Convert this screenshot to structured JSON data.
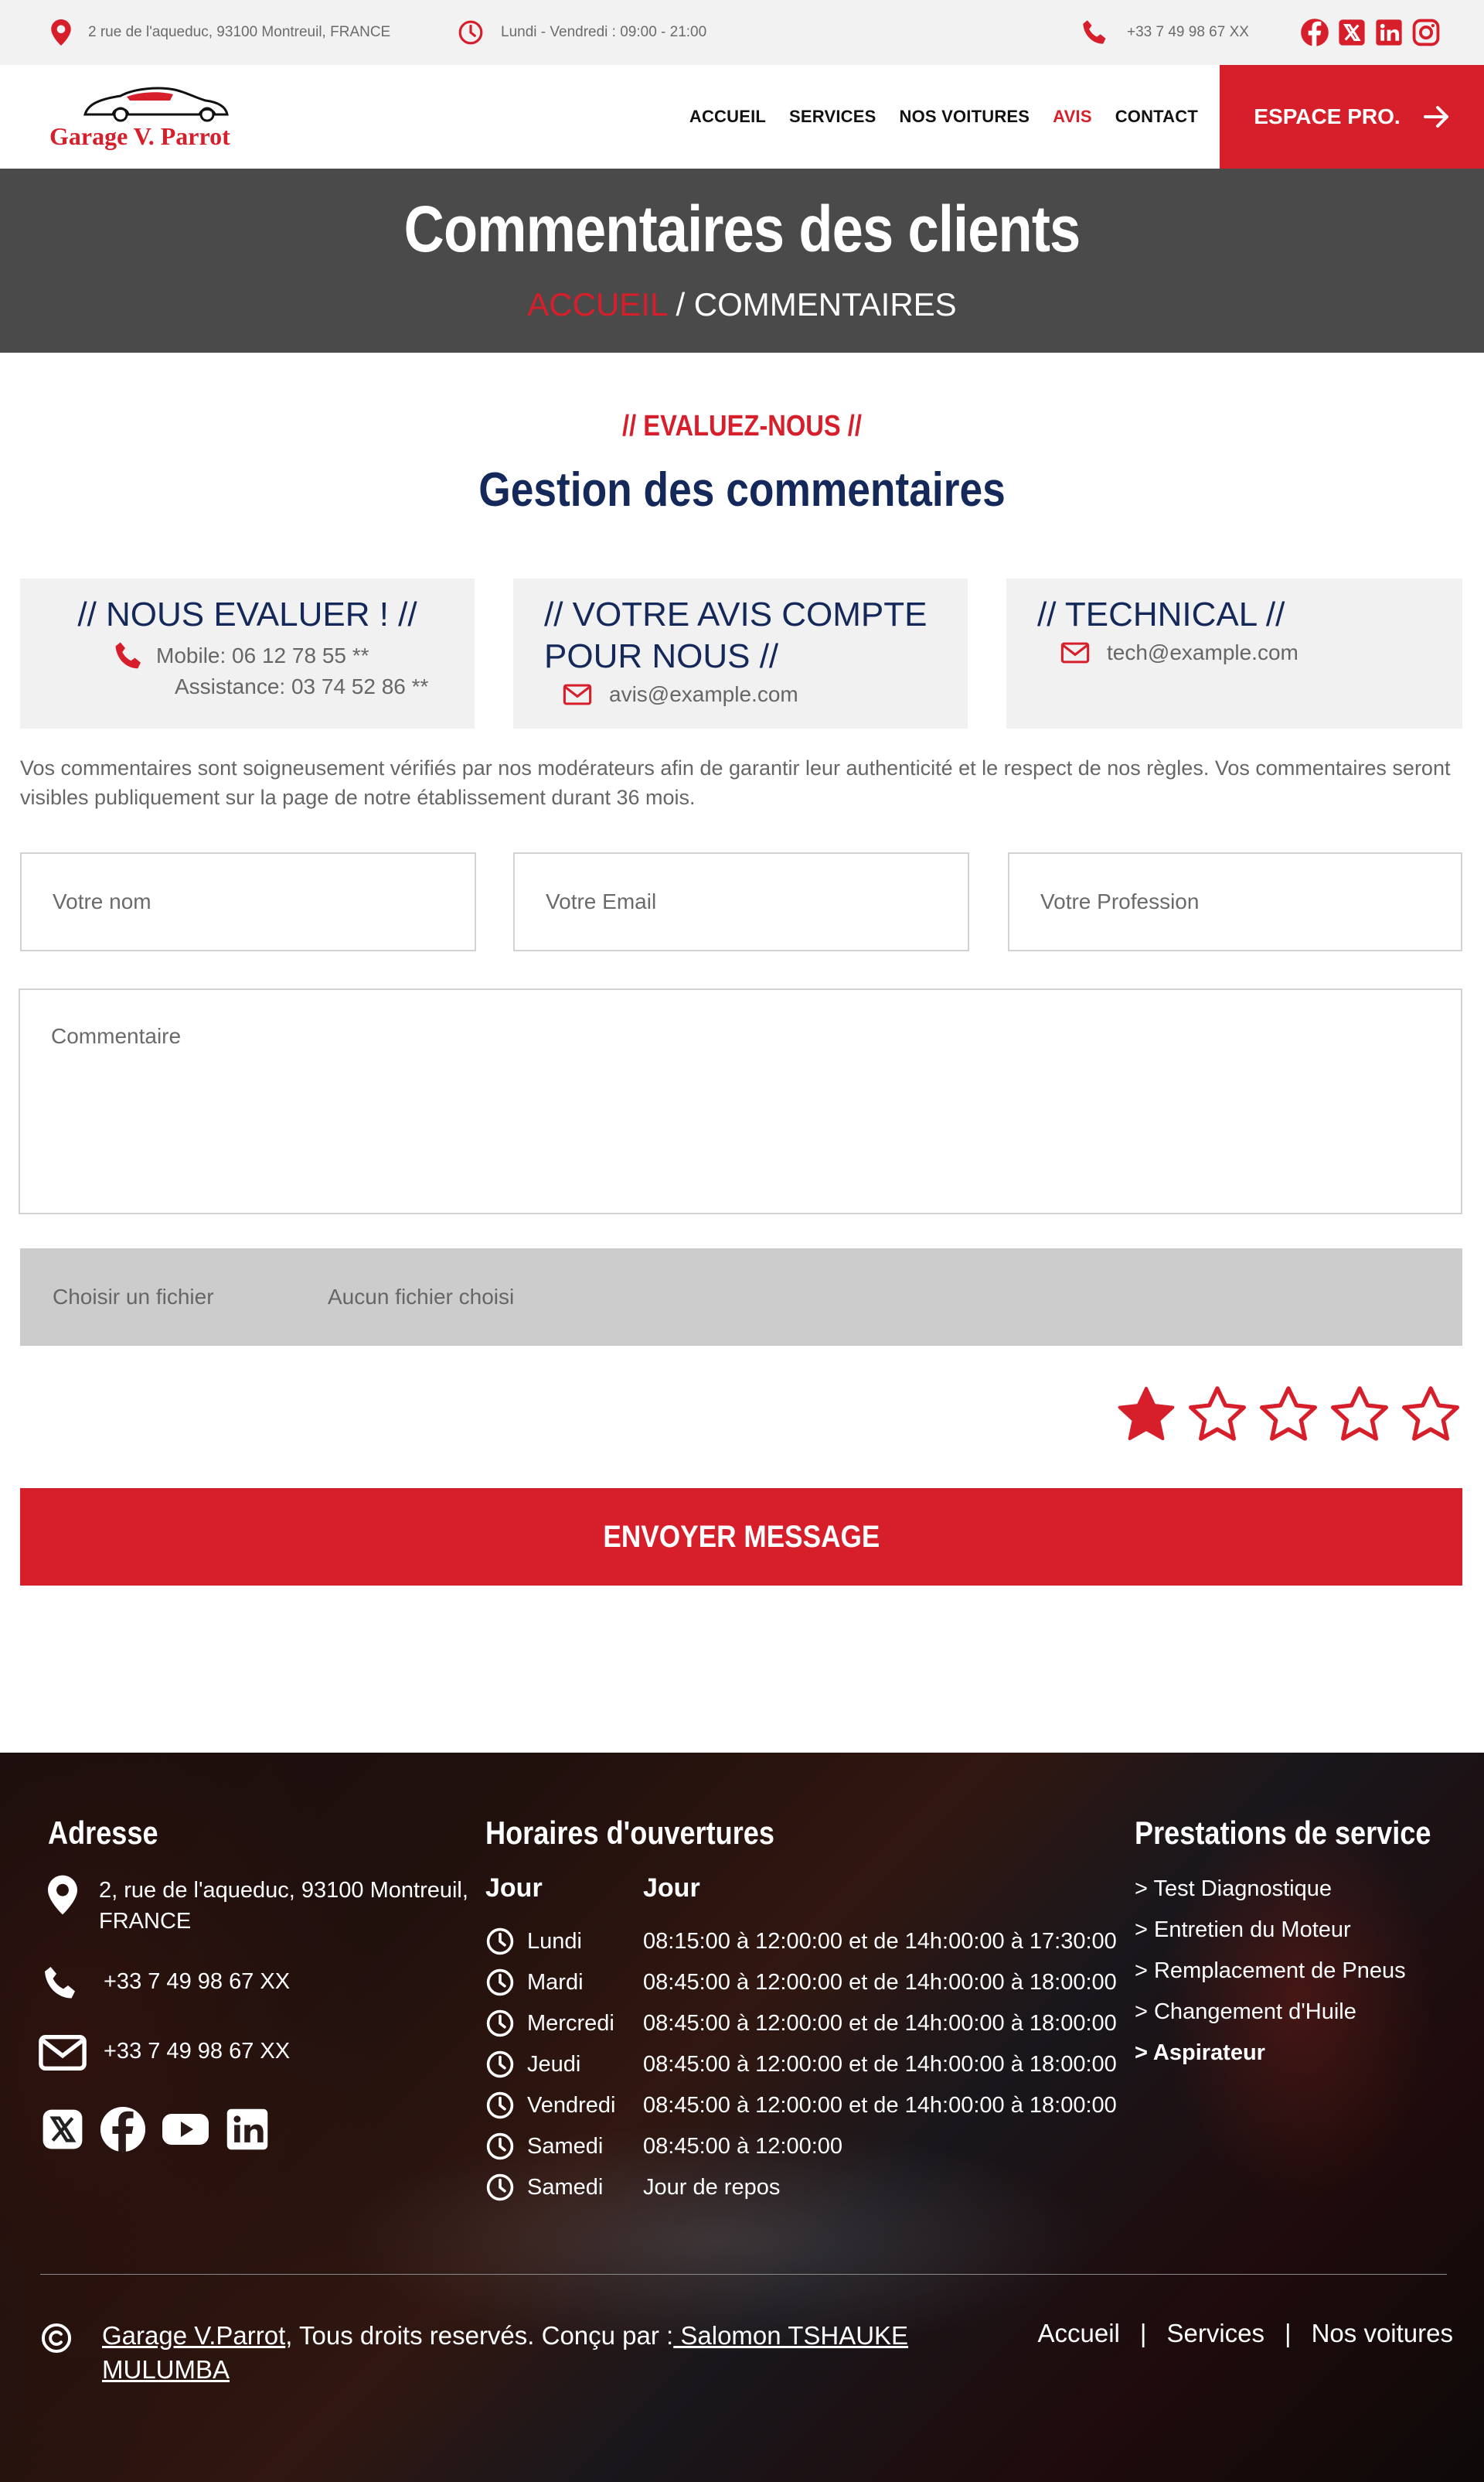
{
  "topbar": {
    "address": "2 rue de l'aqueduc, 93100 Montreuil, FRANCE",
    "hours": "Lundi - Vendredi : 09:00 - 21:00",
    "phone": "+33 7 49 98 67 XX"
  },
  "header": {
    "logo_text": "Garage V. Parrot",
    "nav": [
      "ACCUEIL",
      "SERVICES",
      "NOS VOITURES",
      "AVIS",
      "CONTACT"
    ],
    "active_nav": "AVIS",
    "espace_label": "ESPACE PRO."
  },
  "hero": {
    "title": "Commentaires des clients",
    "crumb_home": "ACCUEIL",
    "crumb_sep": " / ",
    "crumb_current": "COMMENTAIRES"
  },
  "section": {
    "eyebrow": "// EVALUEZ-NOUS //",
    "title": "Gestion des commentaires"
  },
  "cards": {
    "evaluate": {
      "title": "// NOUS EVALUER ! //",
      "mobile": "Mobile: 06 12 78 55 **",
      "assistance": "Assistance: 03 74 52 86 **"
    },
    "opinion": {
      "title_line1": "// VOTRE AVIS COMPTE",
      "title_line2": "POUR NOUS //",
      "email": "avis@example.com"
    },
    "technical": {
      "title": "// TECHNICAL //",
      "email": "tech@example.com"
    }
  },
  "notice": "Vos commentaires sont soigneusement vérifiés par nos modérateurs afin de garantir leur authenticité et le respect de nos règles. Vos commentaires seront visibles publiquement sur la page de notre établissement durant 36 mois.",
  "form": {
    "name_placeholder": "Votre nom",
    "email_placeholder": "Votre Email",
    "profession_placeholder": "Votre Profession",
    "comment_placeholder": "Commentaire",
    "file_button": "Choisir un fichier",
    "file_status": "Aucun fichier choisi",
    "rating": 1,
    "rating_max": 5,
    "submit_label": "ENVOYER MESSAGE"
  },
  "footer": {
    "address_title": "Adresse",
    "address_line1": "2, rue de l'aqueduc, 93100 Montreuil,",
    "address_line2": "FRANCE",
    "phone": "+33 7 49 98 67 XX",
    "email_line": "+33 7 49 98 67 XX",
    "hours_title": "Horaires d'ouvertures",
    "hours_col1": "Jour",
    "hours_col2": "Jour",
    "hours": [
      {
        "day": "Lundi",
        "time": "08:15:00 à 12:00:00 et de 14h:00:00 à 17:30:00"
      },
      {
        "day": "Mardi",
        "time": "08:45:00 à 12:00:00 et de 14h:00:00 à 18:00:00"
      },
      {
        "day": "Mercredi",
        "time": "08:45:00 à 12:00:00 et de 14h:00:00 à 18:00:00"
      },
      {
        "day": "Jeudi",
        "time": "08:45:00 à 12:00:00 et de 14h:00:00 à 18:00:00"
      },
      {
        "day": "Vendredi",
        "time": "08:45:00 à 12:00:00 et de 14h:00:00 à 18:00:00"
      },
      {
        "day": "Samedi",
        "time": "08:45:00 à 12:00:00"
      },
      {
        "day": "Samedi",
        "time": "Jour de repos"
      }
    ],
    "services_title": "Prestations de service",
    "services": [
      "> Test Diagnostique",
      "> Entretien du Moteur",
      "> Remplacement de Pneus",
      "> Changement d'Huile",
      "> Aspirateur"
    ],
    "copyright_brand": "Garage V.Parrot",
    "copyright_text": ", Tous droits reservés. Conçu par :",
    "copyright_author": " Salomon TSHAUKE MULUMBA",
    "links": [
      "Accueil",
      "Services",
      "Nos voitures"
    ],
    "link_sep": "|"
  },
  "colors": {
    "brand_red": "#d71f2b",
    "navy": "#14285a",
    "hero_bg": "#4a4a4a"
  }
}
